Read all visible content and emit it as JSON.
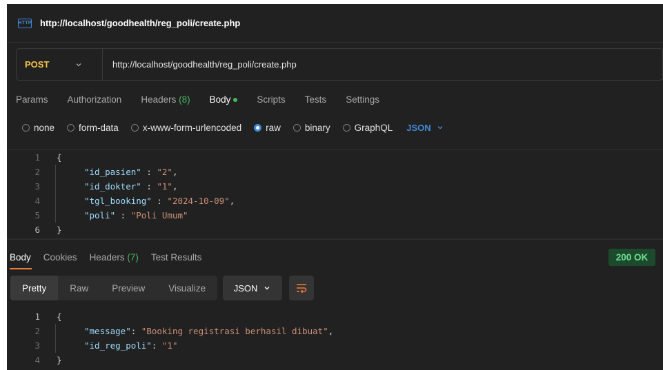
{
  "title": {
    "url": "http://localhost/goodhealth/reg_poli/create.php",
    "badge": "HTTP"
  },
  "request": {
    "method": "POST",
    "url": "http://localhost/goodhealth/reg_poli/create.php"
  },
  "req_tabs": {
    "params": "Params",
    "authorization": "Authorization",
    "headers": "Headers",
    "headers_count": "(8)",
    "body": "Body",
    "scripts": "Scripts",
    "tests": "Tests",
    "settings": "Settings"
  },
  "body_types": {
    "none": "none",
    "form_data": "form-data",
    "urlencoded": "x-www-form-urlencoded",
    "raw": "raw",
    "binary": "binary",
    "graphql": "GraphQL",
    "format": "JSON"
  },
  "request_body": {
    "line_numbers": [
      "1",
      "2",
      "3",
      "4",
      "5",
      "6"
    ],
    "open": "{",
    "close": "}",
    "fields": [
      {
        "key": "\"id_pasien\"",
        "sep": " : ",
        "value": "\"2\"",
        "comma": ","
      },
      {
        "key": "\"id_dokter\"",
        "sep": " : ",
        "value": "\"1\"",
        "comma": ","
      },
      {
        "key": "\"tgl_booking\"",
        "sep": " : ",
        "value": "\"2024-10-09\"",
        "comma": ","
      },
      {
        "key": "\"poli\"",
        "sep": " : ",
        "value": "\"Poli Umum\"",
        "comma": ""
      }
    ]
  },
  "resp_tabs": {
    "body": "Body",
    "cookies": "Cookies",
    "headers": "Headers",
    "headers_count": "(7)",
    "test_results": "Test Results"
  },
  "status": {
    "text": "200 OK",
    "color": "#6ee091"
  },
  "view_modes": {
    "pretty": "Pretty",
    "raw": "Raw",
    "preview": "Preview",
    "visualize": "Visualize",
    "format": "JSON"
  },
  "response_body": {
    "line_numbers": [
      "1",
      "2",
      "3",
      "4"
    ],
    "open": "{",
    "close": "}",
    "fields": [
      {
        "key": "\"message\"",
        "sep": ": ",
        "value": "\"Booking registrasi berhasil dibuat\"",
        "comma": ","
      },
      {
        "key": "\"id_reg_poli\"",
        "sep": ": ",
        "value": "\"1\"",
        "comma": ""
      }
    ]
  },
  "colors": {
    "accent": "#3f8bd8",
    "method": "#f6c34a",
    "tab_underline": "#f07d3a",
    "success": "#49b760"
  }
}
